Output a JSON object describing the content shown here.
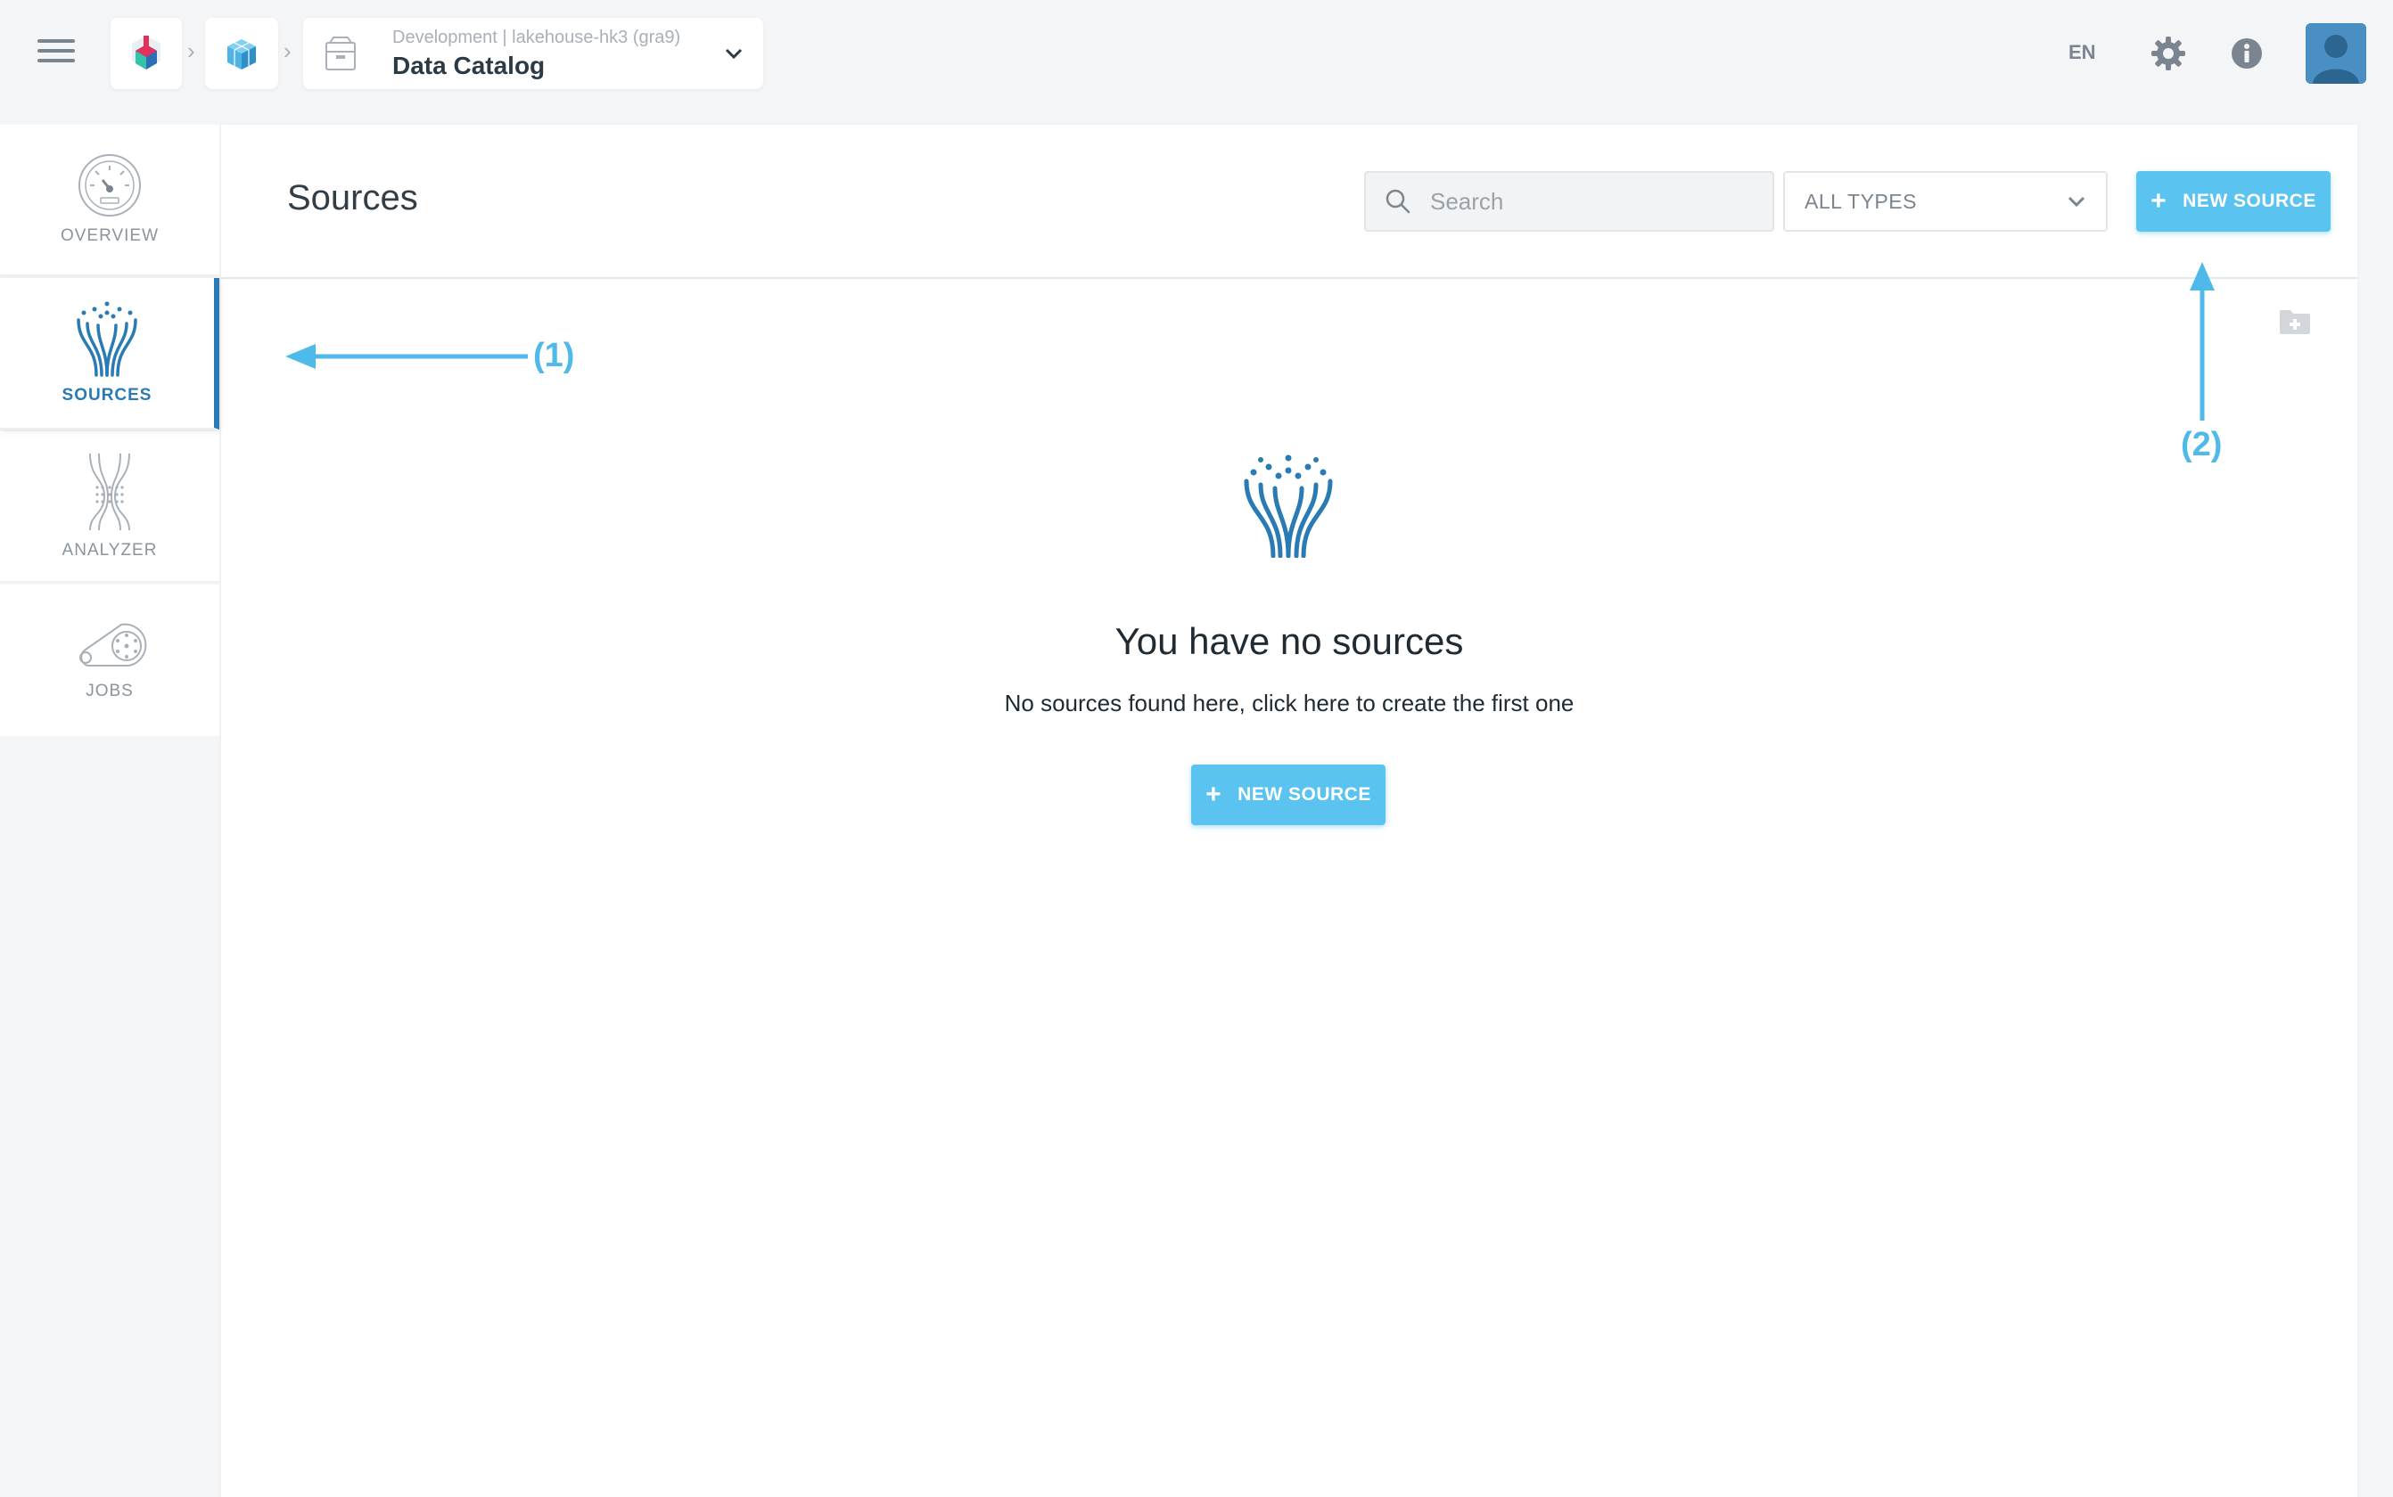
{
  "topbar": {
    "context_subtitle": "Development | lakehouse-hk3 (gra9)",
    "context_title": "Data Catalog",
    "language": "EN",
    "icons": {
      "menu": "hamburger-menu-icon",
      "app_logo": "app-logo-icon",
      "project": "cube-icon",
      "catalog": "archive-box-icon",
      "settings": "gear-icon",
      "info": "info-icon",
      "avatar": "user-avatar"
    }
  },
  "sidebar": {
    "items": [
      {
        "label": "OVERVIEW",
        "icon": "gauge-icon",
        "active": false
      },
      {
        "label": "SOURCES",
        "icon": "sources-tree-icon",
        "active": true
      },
      {
        "label": "ANALYZER",
        "icon": "analyzer-funnel-icon",
        "active": false
      },
      {
        "label": "JOBS",
        "icon": "conveyor-belt-icon",
        "active": false
      }
    ]
  },
  "main": {
    "title": "Sources",
    "search": {
      "placeholder": "Search",
      "value": ""
    },
    "type_filter": {
      "selected": "ALL TYPES"
    },
    "new_source_button": {
      "plus": "+",
      "label": "NEW SOURCE"
    },
    "empty_state": {
      "title": "You have no sources",
      "subtitle": "No sources found here, click here to create the first one",
      "button_plus": "+",
      "button_label": "NEW SOURCE"
    }
  },
  "annotations": {
    "one": "(1)",
    "two": "(2)"
  },
  "colors": {
    "accent": "#5ac3ef",
    "active_nav": "#2a7ab3",
    "annotation": "#4fb9ea",
    "background": "#f4f5f7"
  }
}
